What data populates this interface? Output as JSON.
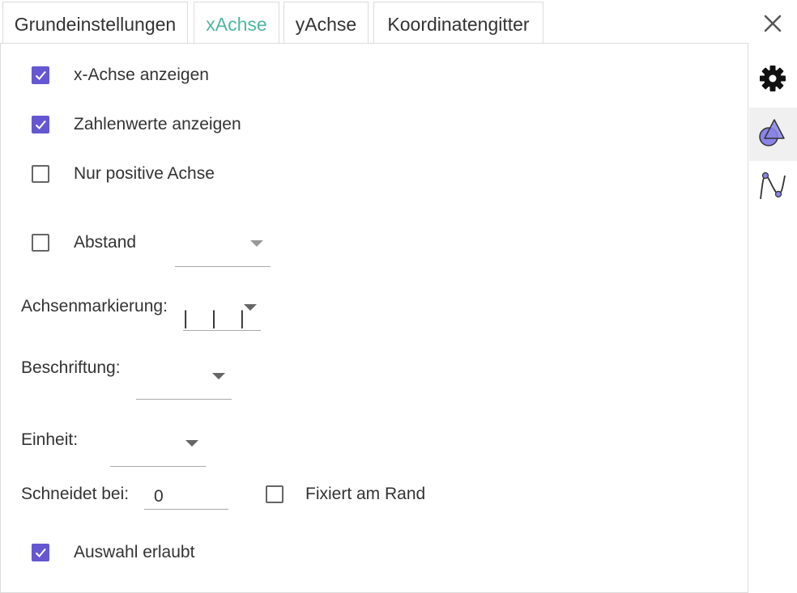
{
  "tabs": [
    {
      "label": "Grundeinstellungen"
    },
    {
      "label": "xAchse",
      "active": true
    },
    {
      "label": "yAchse"
    },
    {
      "label": "Koordinatengitter"
    }
  ],
  "options": {
    "show_x_axis": {
      "label": "x-Achse anzeigen",
      "checked": true
    },
    "show_numbers": {
      "label": "Zahlenwerte anzeigen",
      "checked": true
    },
    "positive_only": {
      "label": "Nur positive Achse",
      "checked": false
    },
    "distance": {
      "label": "Abstand",
      "checked": false
    },
    "axis_ticks": {
      "label": "Achsenmarkierung:",
      "value": "| | |"
    },
    "label": {
      "label": "Beschriftung:"
    },
    "unit": {
      "label": "Einheit:"
    },
    "crossing": {
      "label": "Schneidet bei:",
      "value": "0"
    },
    "fixed_at_edge": {
      "label": "Fixiert am Rand",
      "checked": false
    },
    "selection_allowed": {
      "label": "Auswahl erlaubt",
      "checked": true
    }
  },
  "sidebar": {
    "icons": [
      "close-icon",
      "gear-icon",
      "shapes-icon",
      "graph-icon"
    ],
    "active": "shapes-icon"
  },
  "colors": {
    "accent": "#4fb7a1",
    "checkbox": "#6557d2"
  }
}
